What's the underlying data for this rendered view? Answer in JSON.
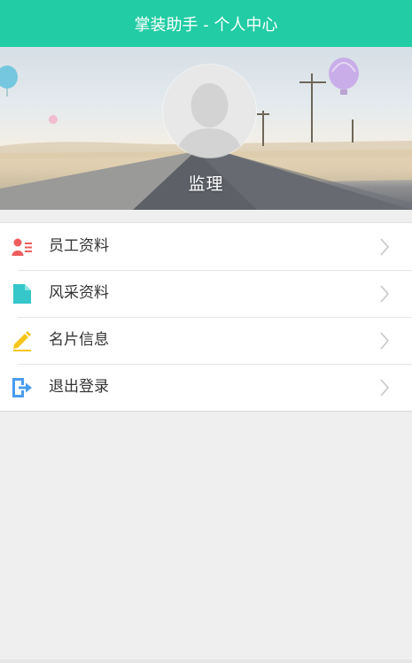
{
  "topbar": {
    "title": "掌装助手 - 个人中心"
  },
  "profile": {
    "name": "监理",
    "avatar_icon": "default-avatar-icon"
  },
  "menu": {
    "items": [
      {
        "label": "员工资料",
        "icon": "employee-card-icon",
        "color": "#f05d5d"
      },
      {
        "label": "风采资料",
        "icon": "document-icon",
        "color": "#35c7c9"
      },
      {
        "label": "名片信息",
        "icon": "pencil-icon",
        "color": "#f5c518"
      },
      {
        "label": "退出登录",
        "icon": "logout-icon",
        "color": "#4a9cf0"
      }
    ],
    "chevron_icon": "chevron-right-icon"
  },
  "colors": {
    "accent": "#22cca4",
    "background": "#efefef",
    "text": "#333333"
  }
}
